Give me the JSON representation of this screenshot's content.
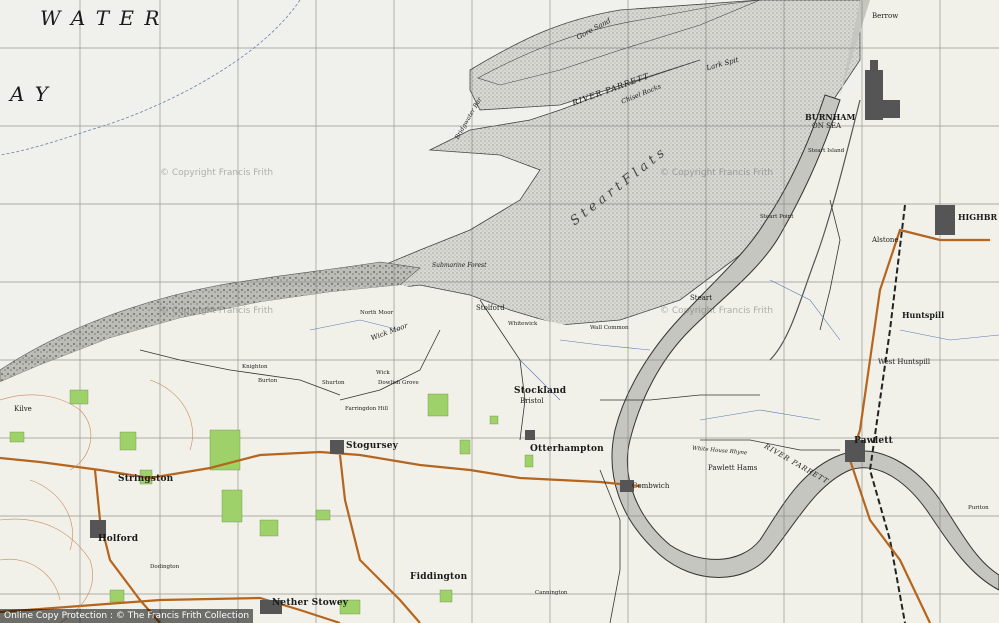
{
  "map": {
    "sea_text_1": "W A T E R",
    "sea_text_2": "A Y",
    "river_label_1": "RIVER PARRETT",
    "river_label_2": "RIVER PARRETT",
    "gore_sand": "Gore Sand",
    "lark_spit": "Lark Spit",
    "chisel_rocks": "Chisel Rocks",
    "steart_flats": "S t e a r t     F l a t s",
    "submarine_forest": "Submarine Forest",
    "bridgwater_bar": "Bridgwater Bar",
    "towns": {
      "burnham": "BURNHAM",
      "burnham_sea": "ON SEA",
      "highbridge": "HIGHBR",
      "berrow": "Berrow",
      "stockland": "Stockland",
      "bristol": "Bristol",
      "otterhampton": "Otterhampton",
      "stogursey": "Stogursey",
      "stringston": "Stringston",
      "holford": "Holford",
      "fiddington": "Fiddington",
      "nether_stowey": "Nether Stowey",
      "kilve": "Kilve",
      "pawlett": "Pawlett",
      "huntspill": "Huntspill",
      "west_huntspill": "West Huntspill",
      "steart": "Steart",
      "stolford": "Stolford",
      "combwich": "Combwich",
      "alstone": "Alstone",
      "wick_moor": "Wick Moor",
      "north_moor": "North Moor",
      "wall_common": "Wall Common",
      "pawlett_hams": "Pawlett Hams",
      "steart_point": "Steart Point",
      "steart_island": "Steart Island",
      "dodington": "Dodington",
      "cannington": "Cannington",
      "shurton": "Shurton",
      "burton": "Burton",
      "knighton": "Knighton",
      "wick": "Wick",
      "dowlish_grove": "Dowlish Grove",
      "farringdon": "Farringdon Hill",
      "combwich_reach": "White House Rhyne",
      "puriton": "Puriton",
      "hillcombe": "Whitewick"
    },
    "watermark": "© Copyright Francis Frith",
    "footer": "Online Copy Protection : © The Francis Frith Collection"
  }
}
